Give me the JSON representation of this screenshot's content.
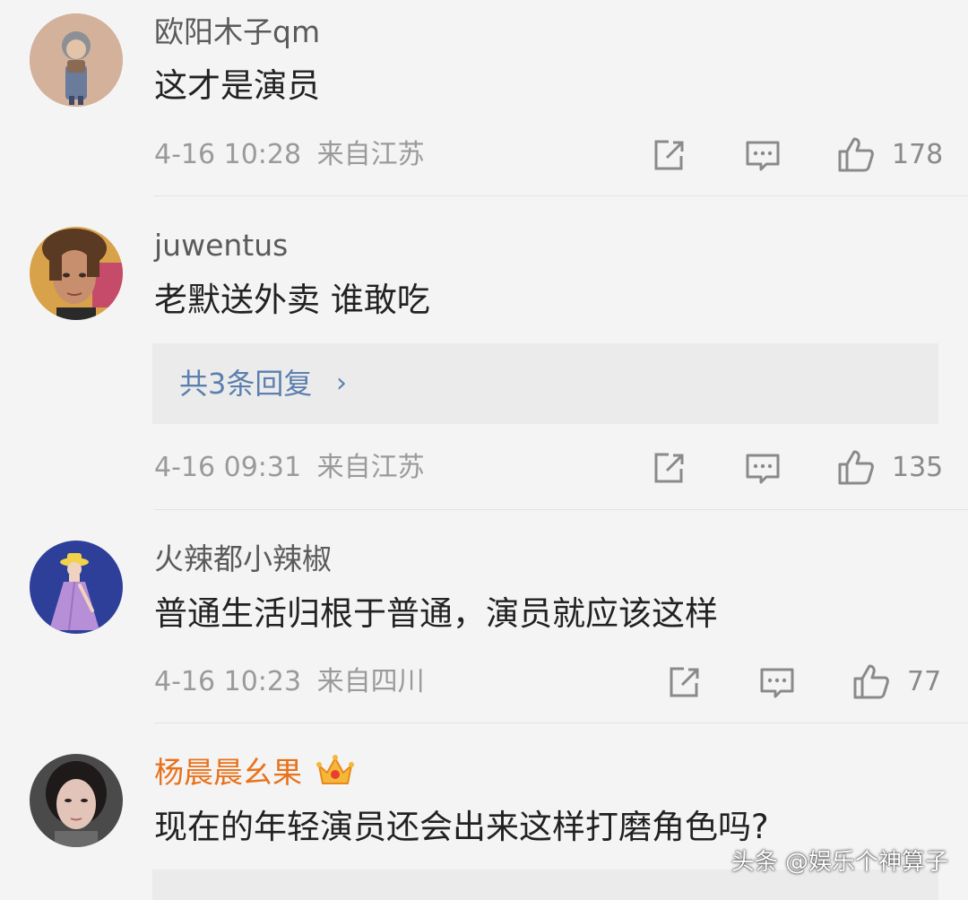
{
  "colors": {
    "background": "#f4f4f4",
    "username": "#5a5a5a",
    "vip_username": "#e8721c",
    "comment_text": "#222222",
    "meta_text": "#9a9a9a",
    "reply_link": "#5b7fae",
    "reply_box": "#ebebeb"
  },
  "comments": [
    {
      "username": "欧阳木子qm",
      "text": "这才是演员",
      "date": "4-16 10:28",
      "location": "来自江苏",
      "likes": "178",
      "icons": [
        "share-icon",
        "comment-icon",
        "like-icon"
      ]
    },
    {
      "username": "juwentus",
      "text": "老默送外卖 谁敢吃",
      "replies": "共3条回复",
      "date": "4-16 09:31",
      "location": "来自江苏",
      "likes": "135",
      "icons": [
        "share-icon",
        "comment-icon",
        "like-icon"
      ]
    },
    {
      "username": "火辣都小辣椒",
      "text": "普通生活归根于普通，演员就应该这样",
      "date": "4-16 10:23",
      "location": "来自四川",
      "likes": "77",
      "icons": [
        "share-icon",
        "comment-icon",
        "like-icon"
      ]
    },
    {
      "username": "杨晨晨幺果",
      "badge": "crown-badge-icon",
      "text": "现在的年轻演员还会出来这样打磨角色吗?"
    }
  ],
  "watermark": "头条 @娱乐个神算子"
}
